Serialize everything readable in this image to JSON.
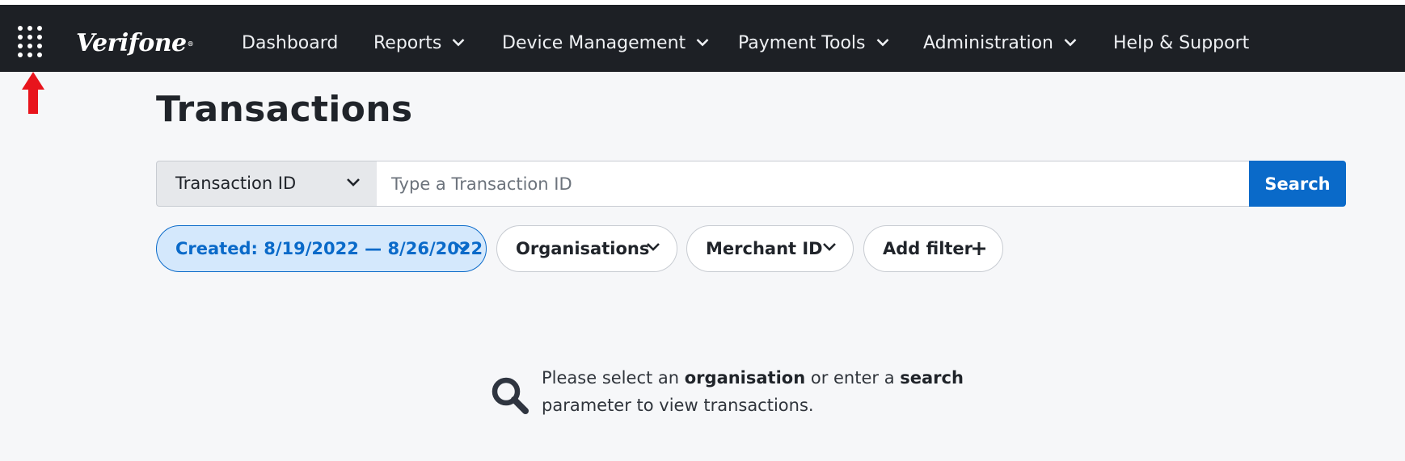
{
  "nav": {
    "logo": "Verifone",
    "items": [
      {
        "label": "Dashboard",
        "dropdown": false
      },
      {
        "label": "Reports",
        "dropdown": true
      },
      {
        "label": "Device Management",
        "dropdown": true
      },
      {
        "label": "Payment Tools",
        "dropdown": true
      },
      {
        "label": "Administration",
        "dropdown": true
      },
      {
        "label": "Help & Support",
        "dropdown": false
      }
    ],
    "apps_icon": "grid-9-dots-icon"
  },
  "page": {
    "title": "Transactions"
  },
  "search": {
    "type_selected": "Transaction ID",
    "placeholder": "Type a Transaction ID",
    "value": "",
    "button_label": "Search"
  },
  "filters": [
    {
      "label": "Created: 8/19/2022 — 8/26/2022",
      "active": true,
      "icon": "chevron-down-icon"
    },
    {
      "label": "Organisations",
      "active": false,
      "icon": "chevron-down-icon"
    },
    {
      "label": "Merchant ID",
      "active": false,
      "icon": "chevron-down-icon"
    },
    {
      "label": "Add filter",
      "active": false,
      "icon": "plus-icon"
    }
  ],
  "empty_state": {
    "icon": "search-icon",
    "text_1": "Please select an ",
    "bold_1": "organisation",
    "text_2": " or enter a ",
    "bold_2": "search",
    "text_3": "parameter to view transactions."
  },
  "colors": {
    "topbar": "#1d2025",
    "accent": "#0a6ac9",
    "active_filter_bg": "#d4e8fc",
    "annotation_arrow": "#e8141c"
  }
}
